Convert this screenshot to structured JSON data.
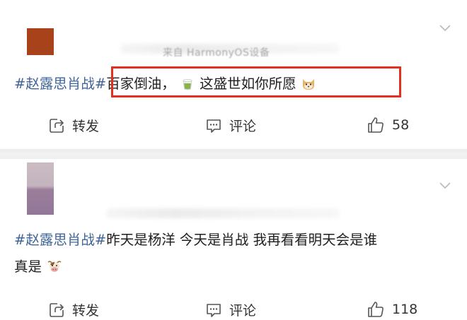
{
  "posts": [
    {
      "source": "来自 HarmonyOS设备",
      "hashtag": "#赵露思肖战#",
      "text_before_emoji": "百家倒油，",
      "text_after_emoji": "这盛世如你所愿",
      "emoji_icons": [
        "matcha-tea-icon",
        "cat-face-icon"
      ],
      "actions": {
        "repost_label": "转发",
        "comment_label": "评论",
        "like_count": "58"
      }
    },
    {
      "hashtag": "#赵露思肖战#",
      "text_line1": "昨天是杨洋 今天是肖战 我再看看明天会是谁",
      "text_line2": "真是",
      "emoji_icons": [
        "cow-face-icon"
      ],
      "actions": {
        "repost_label": "转发",
        "comment_label": "评论",
        "like_count": "118"
      }
    }
  ],
  "colors": {
    "hashtag": "#406599",
    "highlight_border": "#e2301e",
    "avatar_1": "#a8421a"
  }
}
